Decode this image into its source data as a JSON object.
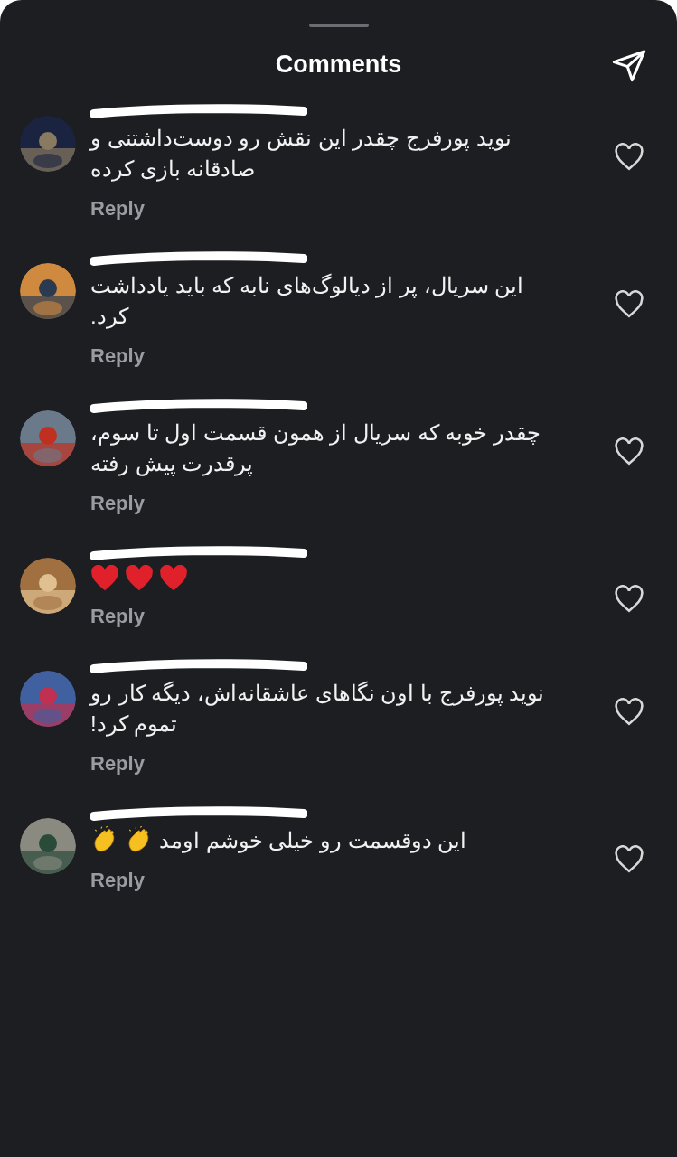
{
  "header": {
    "title": "Comments"
  },
  "comments": [
    {
      "text": "نوید پورفرج چقدر این نقش رو دوست‌داشتنی و صادقانه بازی کرده",
      "reply": "Reply",
      "liked": false
    },
    {
      "text": "این سریال، پر از دیالوگ‌های نابه که باید یادداشت کرد.",
      "reply": "Reply",
      "liked": false
    },
    {
      "text": "چقدر خوبه که سریال از همون قسمت اول تا سوم، پرقدرت پیش رفته",
      "reply": "Reply",
      "liked": false
    },
    {
      "emoji": [
        {
          "kind": "heart"
        },
        {
          "kind": "heart"
        },
        {
          "kind": "heart"
        }
      ],
      "reply": "Reply",
      "liked": false
    },
    {
      "text": "نوید پورفرج با اون نگاهای عاشقانه‌اش، دیگه کار رو تموم کرد!",
      "reply": "Reply",
      "liked": false
    },
    {
      "text": "این دوقسمت  رو خیلی خوشم اومد",
      "emoji": [
        {
          "kind": "clap"
        },
        {
          "kind": "clap"
        }
      ],
      "reply": "Reply",
      "liked": false
    }
  ]
}
